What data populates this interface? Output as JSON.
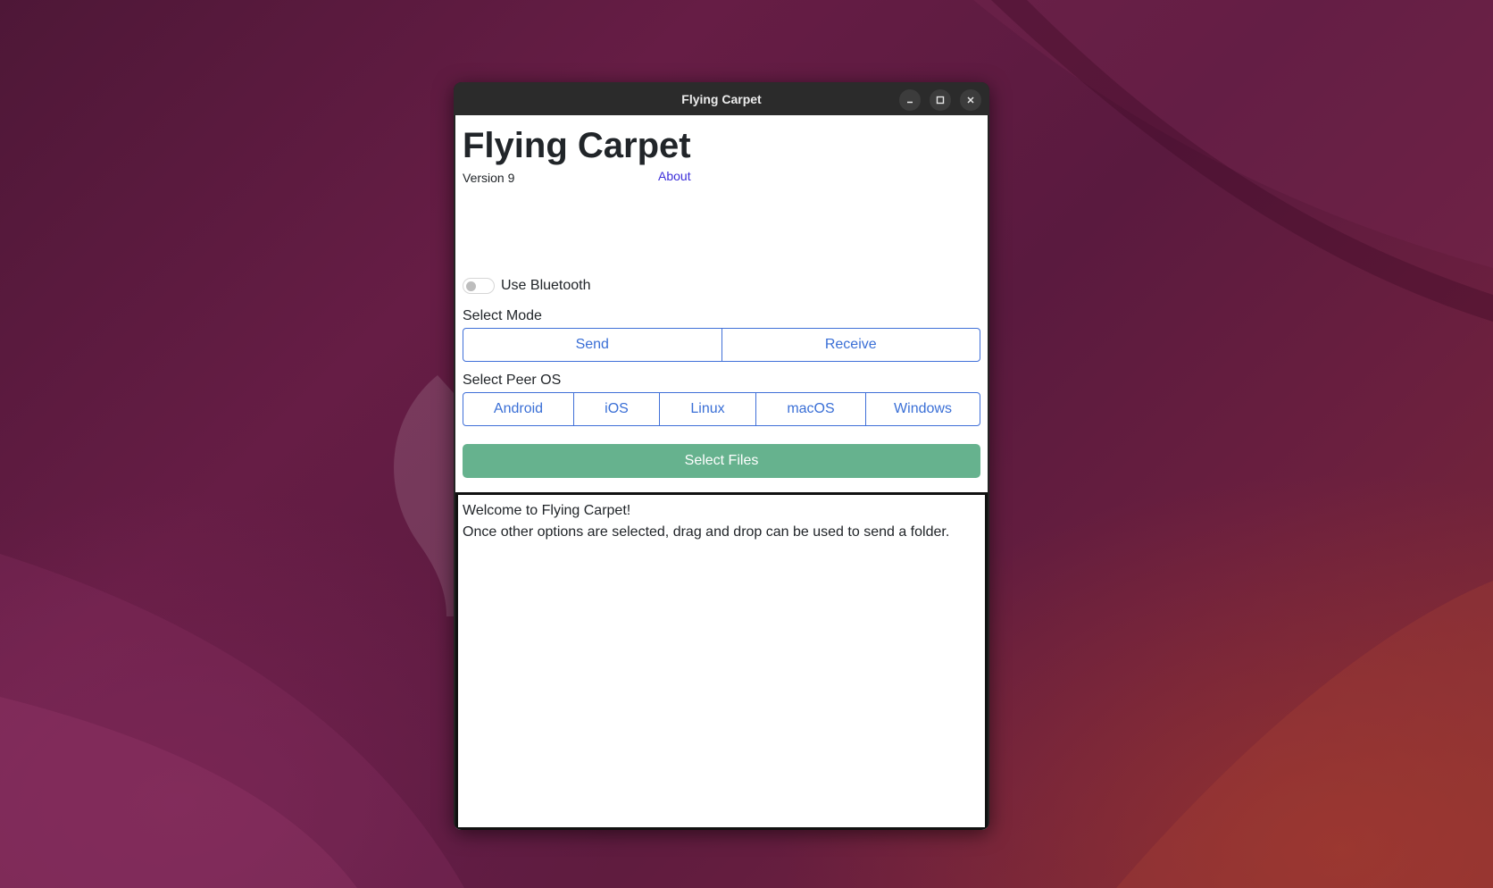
{
  "window": {
    "title": "Flying Carpet",
    "controls": [
      "minimize-icon",
      "maximize-icon",
      "close-icon"
    ]
  },
  "app": {
    "heading": "Flying Carpet",
    "version": "Version 9",
    "about_link": "About"
  },
  "bluetooth": {
    "label": "Use Bluetooth",
    "enabled": false
  },
  "mode": {
    "label": "Select Mode",
    "options": [
      "Send",
      "Receive"
    ]
  },
  "peer_os": {
    "label": "Select Peer OS",
    "options": [
      "Android",
      "iOS",
      "Linux",
      "macOS",
      "Windows"
    ]
  },
  "select_files_label": "Select Files",
  "output": {
    "lines": [
      "Welcome to Flying Carpet!",
      "Once other options are selected, drag and drop can be used to send a folder."
    ]
  },
  "colors": {
    "accent_blue": "#3a6fd6",
    "select_files_green": "#66b28e",
    "about_link": "#3d2fd9",
    "titlebar": "#2b2b2b"
  }
}
